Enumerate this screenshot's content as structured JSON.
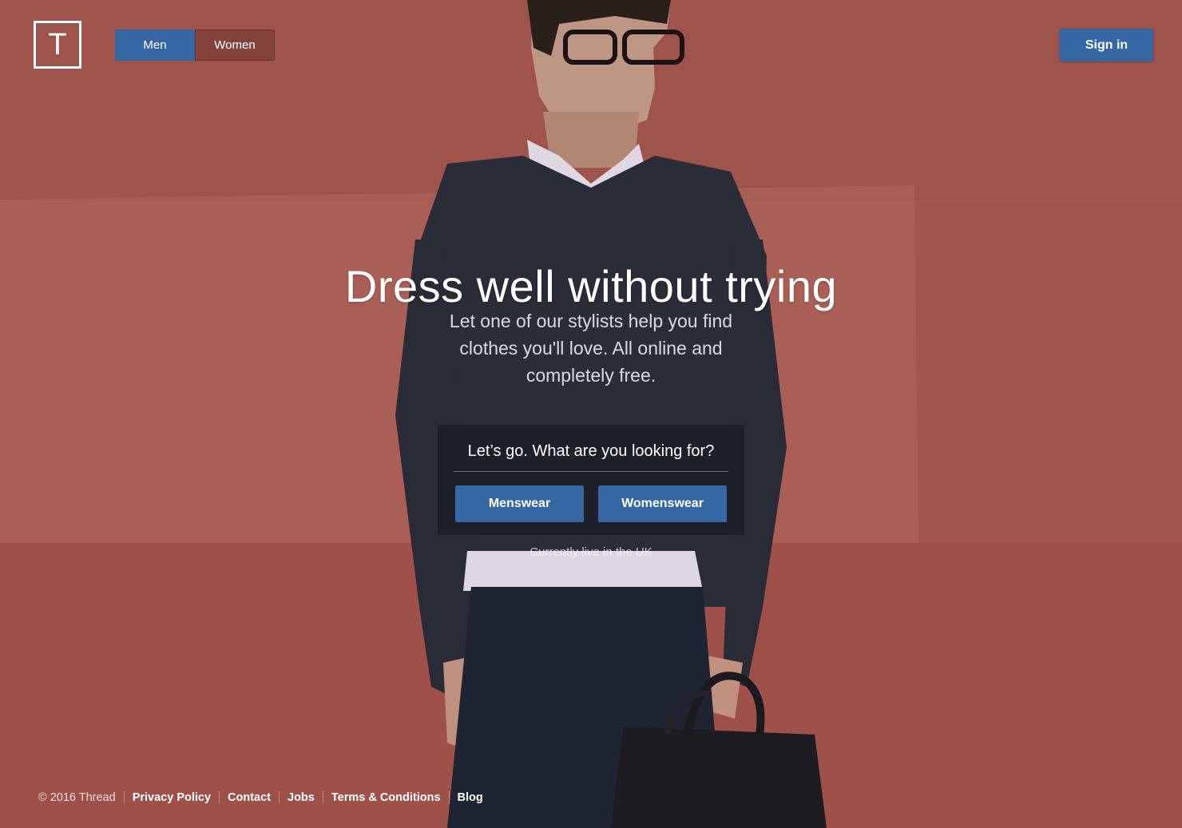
{
  "brand": {
    "logo_letter": "T"
  },
  "nav": {
    "gender_options": [
      {
        "label": "Men",
        "active": true
      },
      {
        "label": "Women",
        "active": false
      }
    ],
    "signin_label": "Sign in"
  },
  "hero": {
    "headline": "Dress well without trying",
    "subhead": "Let one of our stylists help you find clothes you'll love. All online and completely free.",
    "cta": {
      "question": "Let’s go. What are you looking for?",
      "menswear_label": "Menswear",
      "womenswear_label": "Womenswear"
    },
    "availability": "Currently live in the UK"
  },
  "footer": {
    "copyright": "© 2016 Thread",
    "links": [
      "Privacy Policy",
      "Contact",
      "Jobs",
      "Terms & Conditions",
      "Blog"
    ]
  },
  "colors": {
    "accent": "#3467a3",
    "background_wall": "#a95b52",
    "panel": "#1c1f28"
  }
}
